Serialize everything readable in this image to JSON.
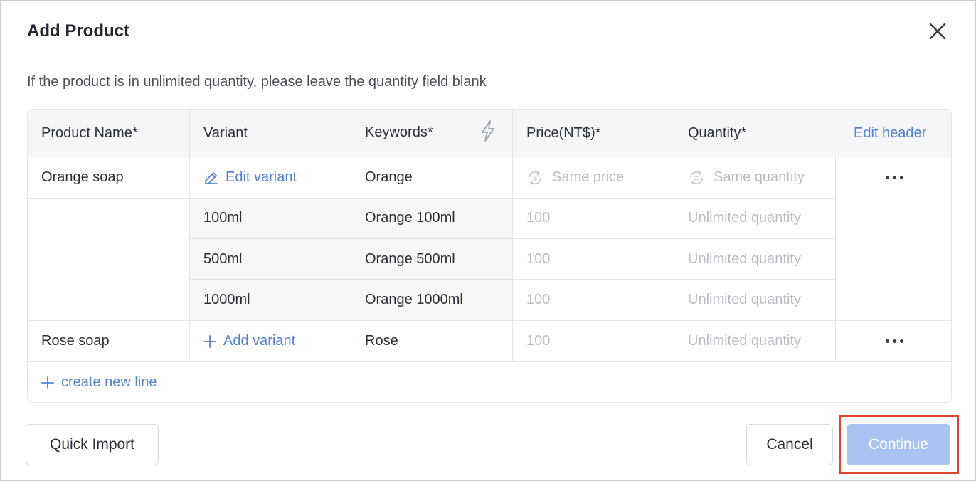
{
  "dialog": {
    "title": "Add Product",
    "hint": "If the product is in unlimited quantity, please leave the quantity field blank"
  },
  "table": {
    "headers": {
      "product_name": "Product Name*",
      "variant": "Variant",
      "keywords": "Keywords*",
      "price": "Price(NT$)*",
      "quantity": "Quantity*",
      "edit_header": "Edit header"
    },
    "orange": {
      "name": "Orange soap",
      "edit_variant": "Edit variant",
      "keyword": "Orange",
      "price_placeholder": "Same price",
      "quantity_placeholder": "Same quantity",
      "variants": [
        {
          "variant": "100ml",
          "keyword": "Orange 100ml",
          "price": "100",
          "quantity": "Unlimited quantity"
        },
        {
          "variant": "500ml",
          "keyword": "Orange 500ml",
          "price": "100",
          "quantity": "Unlimited quantity"
        },
        {
          "variant": "1000ml",
          "keyword": "Orange 1000ml",
          "price": "100",
          "quantity": "Unlimited quantity"
        }
      ]
    },
    "rose": {
      "name": "Rose soap",
      "add_variant": "Add variant",
      "keyword": "Rose",
      "price": "100",
      "quantity": "Unlimited quantity"
    },
    "create_new_line": "create new line"
  },
  "footer": {
    "quick_import": "Quick Import",
    "cancel": "Cancel",
    "continue": "Continue"
  },
  "colors": {
    "accent": "#4f82d8",
    "primary_disabled": "#a9c4f1",
    "highlight": "#e0442c"
  },
  "icons": [
    "close-icon",
    "lightning-icon",
    "pencil-icon",
    "plus-icon",
    "dollar-cycle-icon",
    "cycle-icon",
    "more-icon"
  ]
}
